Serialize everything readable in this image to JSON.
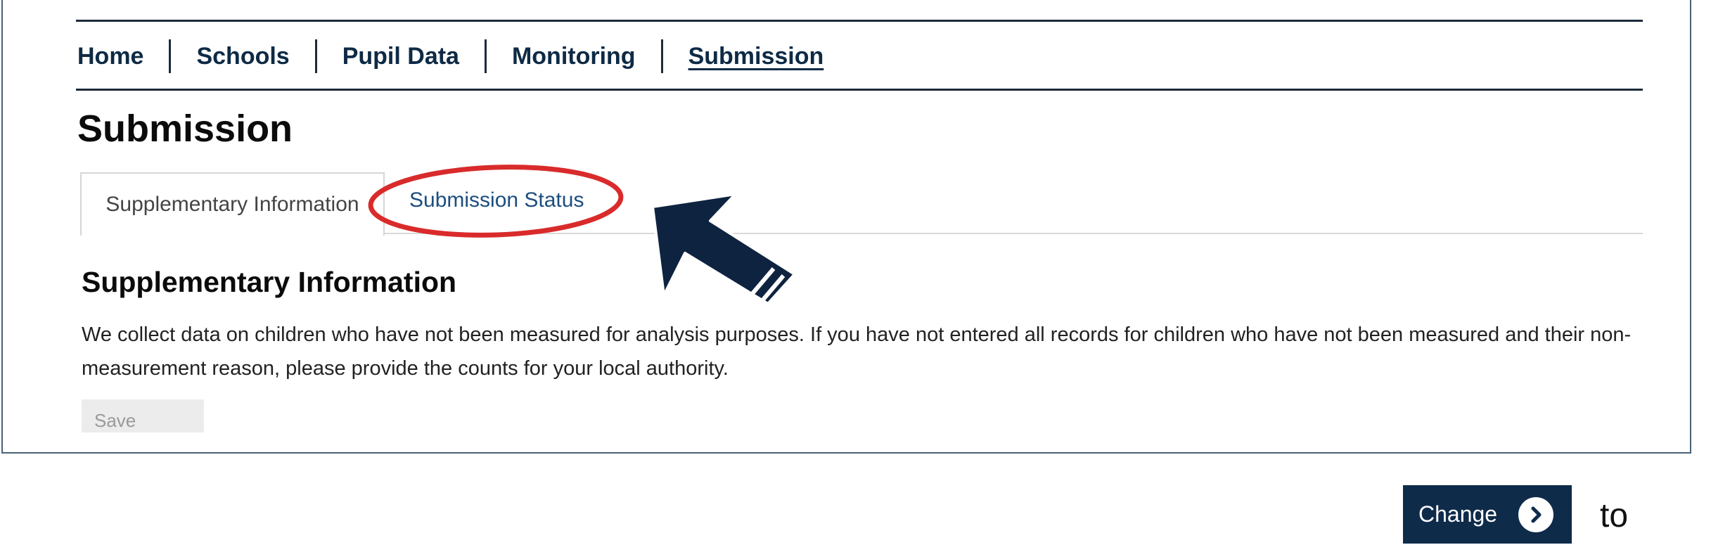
{
  "nav": {
    "items": [
      {
        "label": "Home"
      },
      {
        "label": "Schools"
      },
      {
        "label": "Pupil Data"
      },
      {
        "label": "Monitoring"
      },
      {
        "label": "Submission",
        "active": true
      }
    ]
  },
  "page": {
    "title": "Submission"
  },
  "tabs": [
    {
      "label": "Supplementary Information",
      "selected": true
    },
    {
      "label": "Submission Status",
      "selected": false,
      "highlighted": true
    }
  ],
  "section": {
    "title": "Supplementary Information",
    "body": "We collect data on children who have not been measured for analysis purposes. If you have not entered all records for children who have not been measured and their non-measurement reason, please provide the counts for your local authority."
  },
  "save_button": {
    "label": "Save",
    "disabled": true
  },
  "footer": {
    "change_button": {
      "label": "Change",
      "icon": "chevron-right-circle-icon"
    },
    "trailing_text": "to"
  },
  "colors": {
    "nav_text": "#0e2a45",
    "tab_link": "#1c4e80",
    "highlight_ring": "#d92b2b",
    "arrow": "#0e2340",
    "change_button_bg": "#0f2b4a"
  },
  "icons": {
    "annotation_arrow": "arrow-pointer-icon",
    "annotation_ring": "highlight-ellipse-icon"
  }
}
